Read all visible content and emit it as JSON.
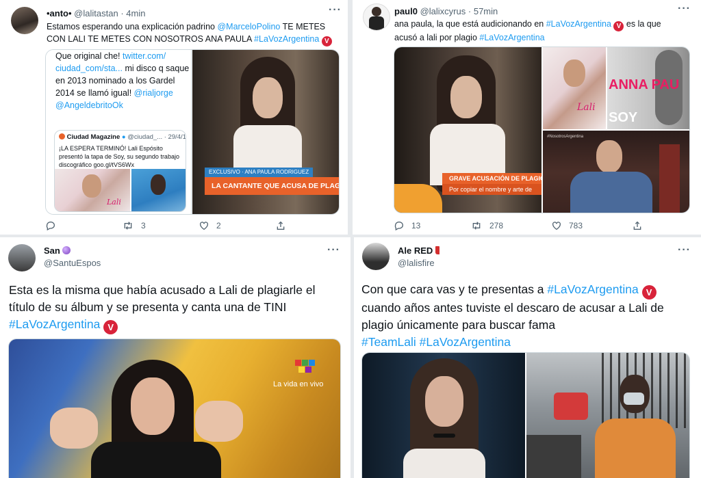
{
  "tweets": [
    {
      "name": "•anto•",
      "handle": "@lalitastan",
      "time": "4min",
      "text_parts": [
        "Estamos esperando una explicación padrino ",
        "@MarceloPolino",
        " TE METES CON LALI TE METES CON NOSOTROS ANA PAULA ",
        "#LaVozArgentina"
      ],
      "quote_lines": [
        "Que original che! ",
        "twitter.com/",
        "ciudad_com/sta...",
        " mi disco q saque en 2013 nominado a los Gardel 2014 se llamó igual! ",
        "@rialjorge",
        "@AngeldebritoOk"
      ],
      "inner_quote": {
        "name": "Ciudad Magazine",
        "handle": "@ciudad_...",
        "date": "· 29/4/16",
        "text": "¡LA ESPERA TERMINÓ! Lali Espósito presentó la tapa de Soy, su segundo trabajo discográfico goo.gl/tVS6Wx",
        "cover_text": "Lali"
      },
      "video_tag": "EXCLUSIVO · ANA PAULA RODRIGUEZ",
      "video_caption": "LA CANTANTE QUE ACUSA DE PLAGIO A LALI ESP",
      "replies": "",
      "retweets": "3",
      "likes": "2"
    },
    {
      "name": "paul0",
      "handle": "@lalixcyrus",
      "time": "57min",
      "text_parts": [
        "ana paula, la que está audicionando en ",
        "#LaVozArgentina",
        " es la que acusó a lali por plagio ",
        "#LaVozArgentina"
      ],
      "video_caption_1": "GRAVE ACUSACIÓN DE PLAGIO CON",
      "video_caption_2": "Por copiar el nombre y arte de",
      "album_text_1": "ANNA PAU",
      "album_text_2": "SOY",
      "cover_text": "Lali",
      "small_tag": "#NosotrosArgentina",
      "replies": "13",
      "retweets": "278",
      "likes": "783"
    },
    {
      "name": "San",
      "handle": "@SantuEspos",
      "text": "Esta es la misma que había acusado a Lali de plagiarle el título de su álbum y se presenta y canta una de TINI ",
      "hashtag": "#LaVozArgentina",
      "tv_text": "La vida en vivo"
    },
    {
      "name": "Ale RED",
      "handle": "@lalisfire",
      "text_1": "Con que cara vas y te presentas a ",
      "hashtag_1": "#LaVozArgentina",
      "text_2": " cuando años antes tuviste el descaro de acusar a Lali de plagio únicamente para buscar fama",
      "hashtag_2": "#TeamLali",
      "hashtag_3": "#LaVozArgentina"
    }
  ],
  "colors": {
    "link": "#1d9bf0",
    "muted": "#536471",
    "badge": "#d8233a",
    "lower_third": "#e8622a"
  },
  "icons": {
    "reply": "reply-icon",
    "retweet": "retweet-icon",
    "like": "heart-icon",
    "share": "share-icon",
    "more": "more-icon"
  }
}
